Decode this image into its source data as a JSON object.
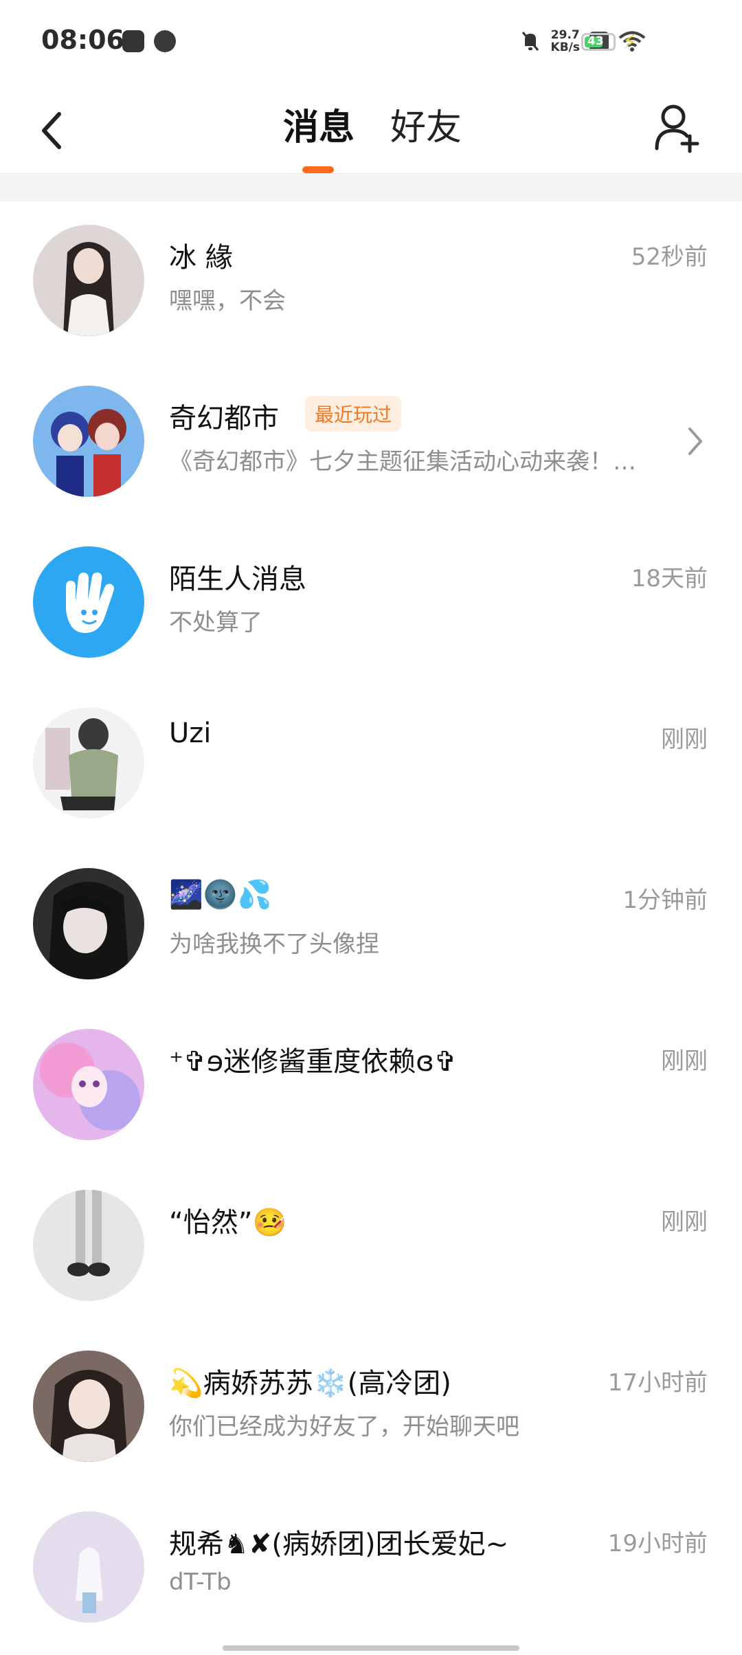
{
  "status_bar": {
    "time": "08:06",
    "net_speed_value": "29.7",
    "net_speed_unit": "KB/s",
    "battery": "43"
  },
  "header": {
    "tabs": [
      {
        "label": "消息",
        "active": true
      },
      {
        "label": "好友",
        "active": false
      }
    ],
    "accent_color": "#ff6a1a"
  },
  "conversations": [
    {
      "name": "冰 緣",
      "preview": "嘿嘿，不会",
      "time": "52秒前",
      "avatar_color": "#d9cfd0"
    },
    {
      "name": "奇幻都市",
      "badge": "最近玩过",
      "preview": "《奇幻都市》七夕主题征集活动心动来袭！…",
      "time": "",
      "avatar_color": "#6a7fd6"
    },
    {
      "name": "陌生人消息",
      "preview": "不处算了",
      "time": "18天前",
      "avatar_color": "#2ea7f2"
    },
    {
      "name": "Uzi",
      "preview": "",
      "time": "刚刚",
      "avatar_color": "#9fa98f"
    },
    {
      "name": "🌌🌚💦",
      "preview": "为啥我换不了头像捏",
      "time": "1分钟前",
      "avatar_color": "#3b3b3b"
    },
    {
      "name": "⁺✞ɘ迷修酱重度依赖ɞ✞",
      "preview": "",
      "time": "刚刚",
      "avatar_color": "#d7a3e3"
    },
    {
      "name": "“怡然”🤒",
      "preview": "",
      "time": "刚刚",
      "avatar_color": "#e6e6e6"
    },
    {
      "name": "💫病娇苏苏❄️(高冷团)",
      "preview": "你们已经成为好友了，开始聊天吧",
      "time": "17小时前",
      "avatar_color": "#6b5a55"
    },
    {
      "name": "规希♞✘(病娇团)团长爱妃~",
      "preview": "dT-Tb",
      "time": "19小时前",
      "avatar_color": "#e3dded"
    }
  ]
}
